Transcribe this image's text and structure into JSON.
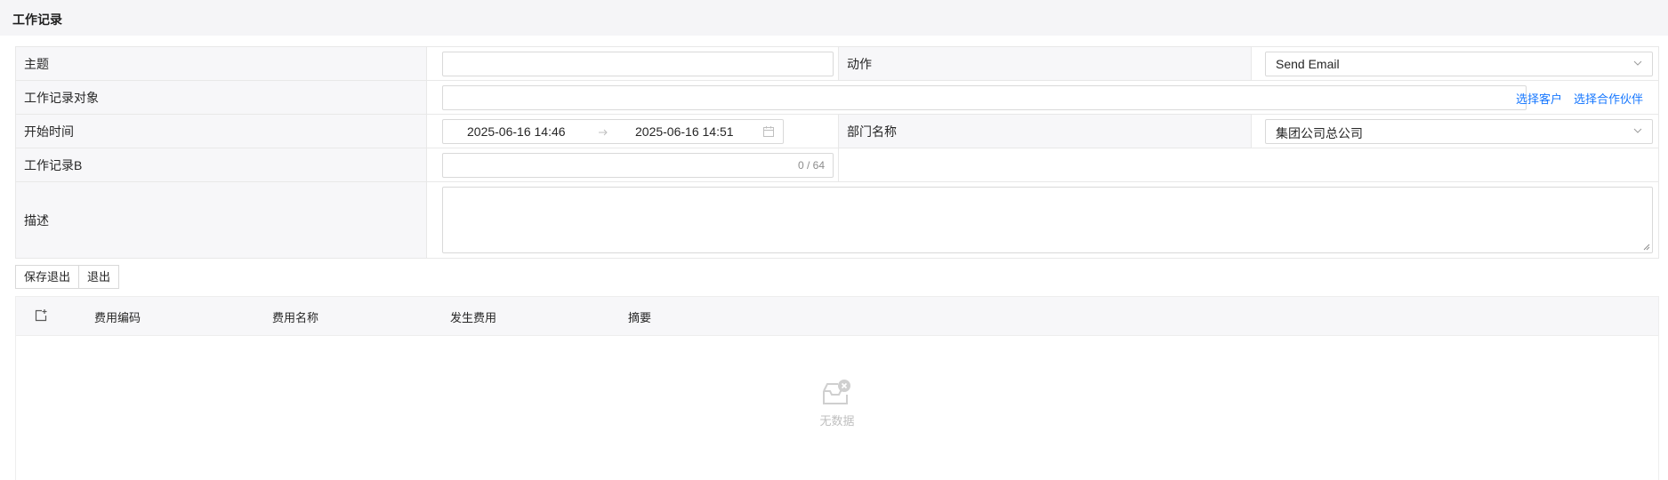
{
  "header": {
    "title": "工作记录"
  },
  "form": {
    "subject_label": "主题",
    "subject_value": "",
    "action_label": "动作",
    "action_value": "Send Email",
    "target_label": "工作记录对象",
    "target_value": "",
    "select_customer": "选择客户",
    "select_partner": "选择合作伙伴",
    "start_time_label": "开始时间",
    "start_time_from": "2025-06-16 14:46",
    "start_time_to": "2025-06-16 14:51",
    "dept_label": "部门名称",
    "dept_value": "集团公司总公司",
    "record_b_label": "工作记录B",
    "record_b_value": "",
    "record_b_counter": "0 / 64",
    "desc_label": "描述",
    "desc_value": ""
  },
  "actions": {
    "save_exit": "保存退出",
    "exit": "退出"
  },
  "table": {
    "columns": [
      "费用编码",
      "费用名称",
      "发生费用",
      "摘要"
    ],
    "rows": [],
    "empty_text": "无数据"
  },
  "icons": {
    "chevron": "chevron-down-icon",
    "arrow": "arrow-right-icon",
    "calendar": "calendar-icon",
    "add_row": "add-row-icon",
    "empty": "empty-inbox-icon",
    "resize": "resize-grip-icon"
  },
  "colors": {
    "link": "#1677ff",
    "label_bg": "#f7f7f9",
    "border": "#e8e8e8"
  }
}
